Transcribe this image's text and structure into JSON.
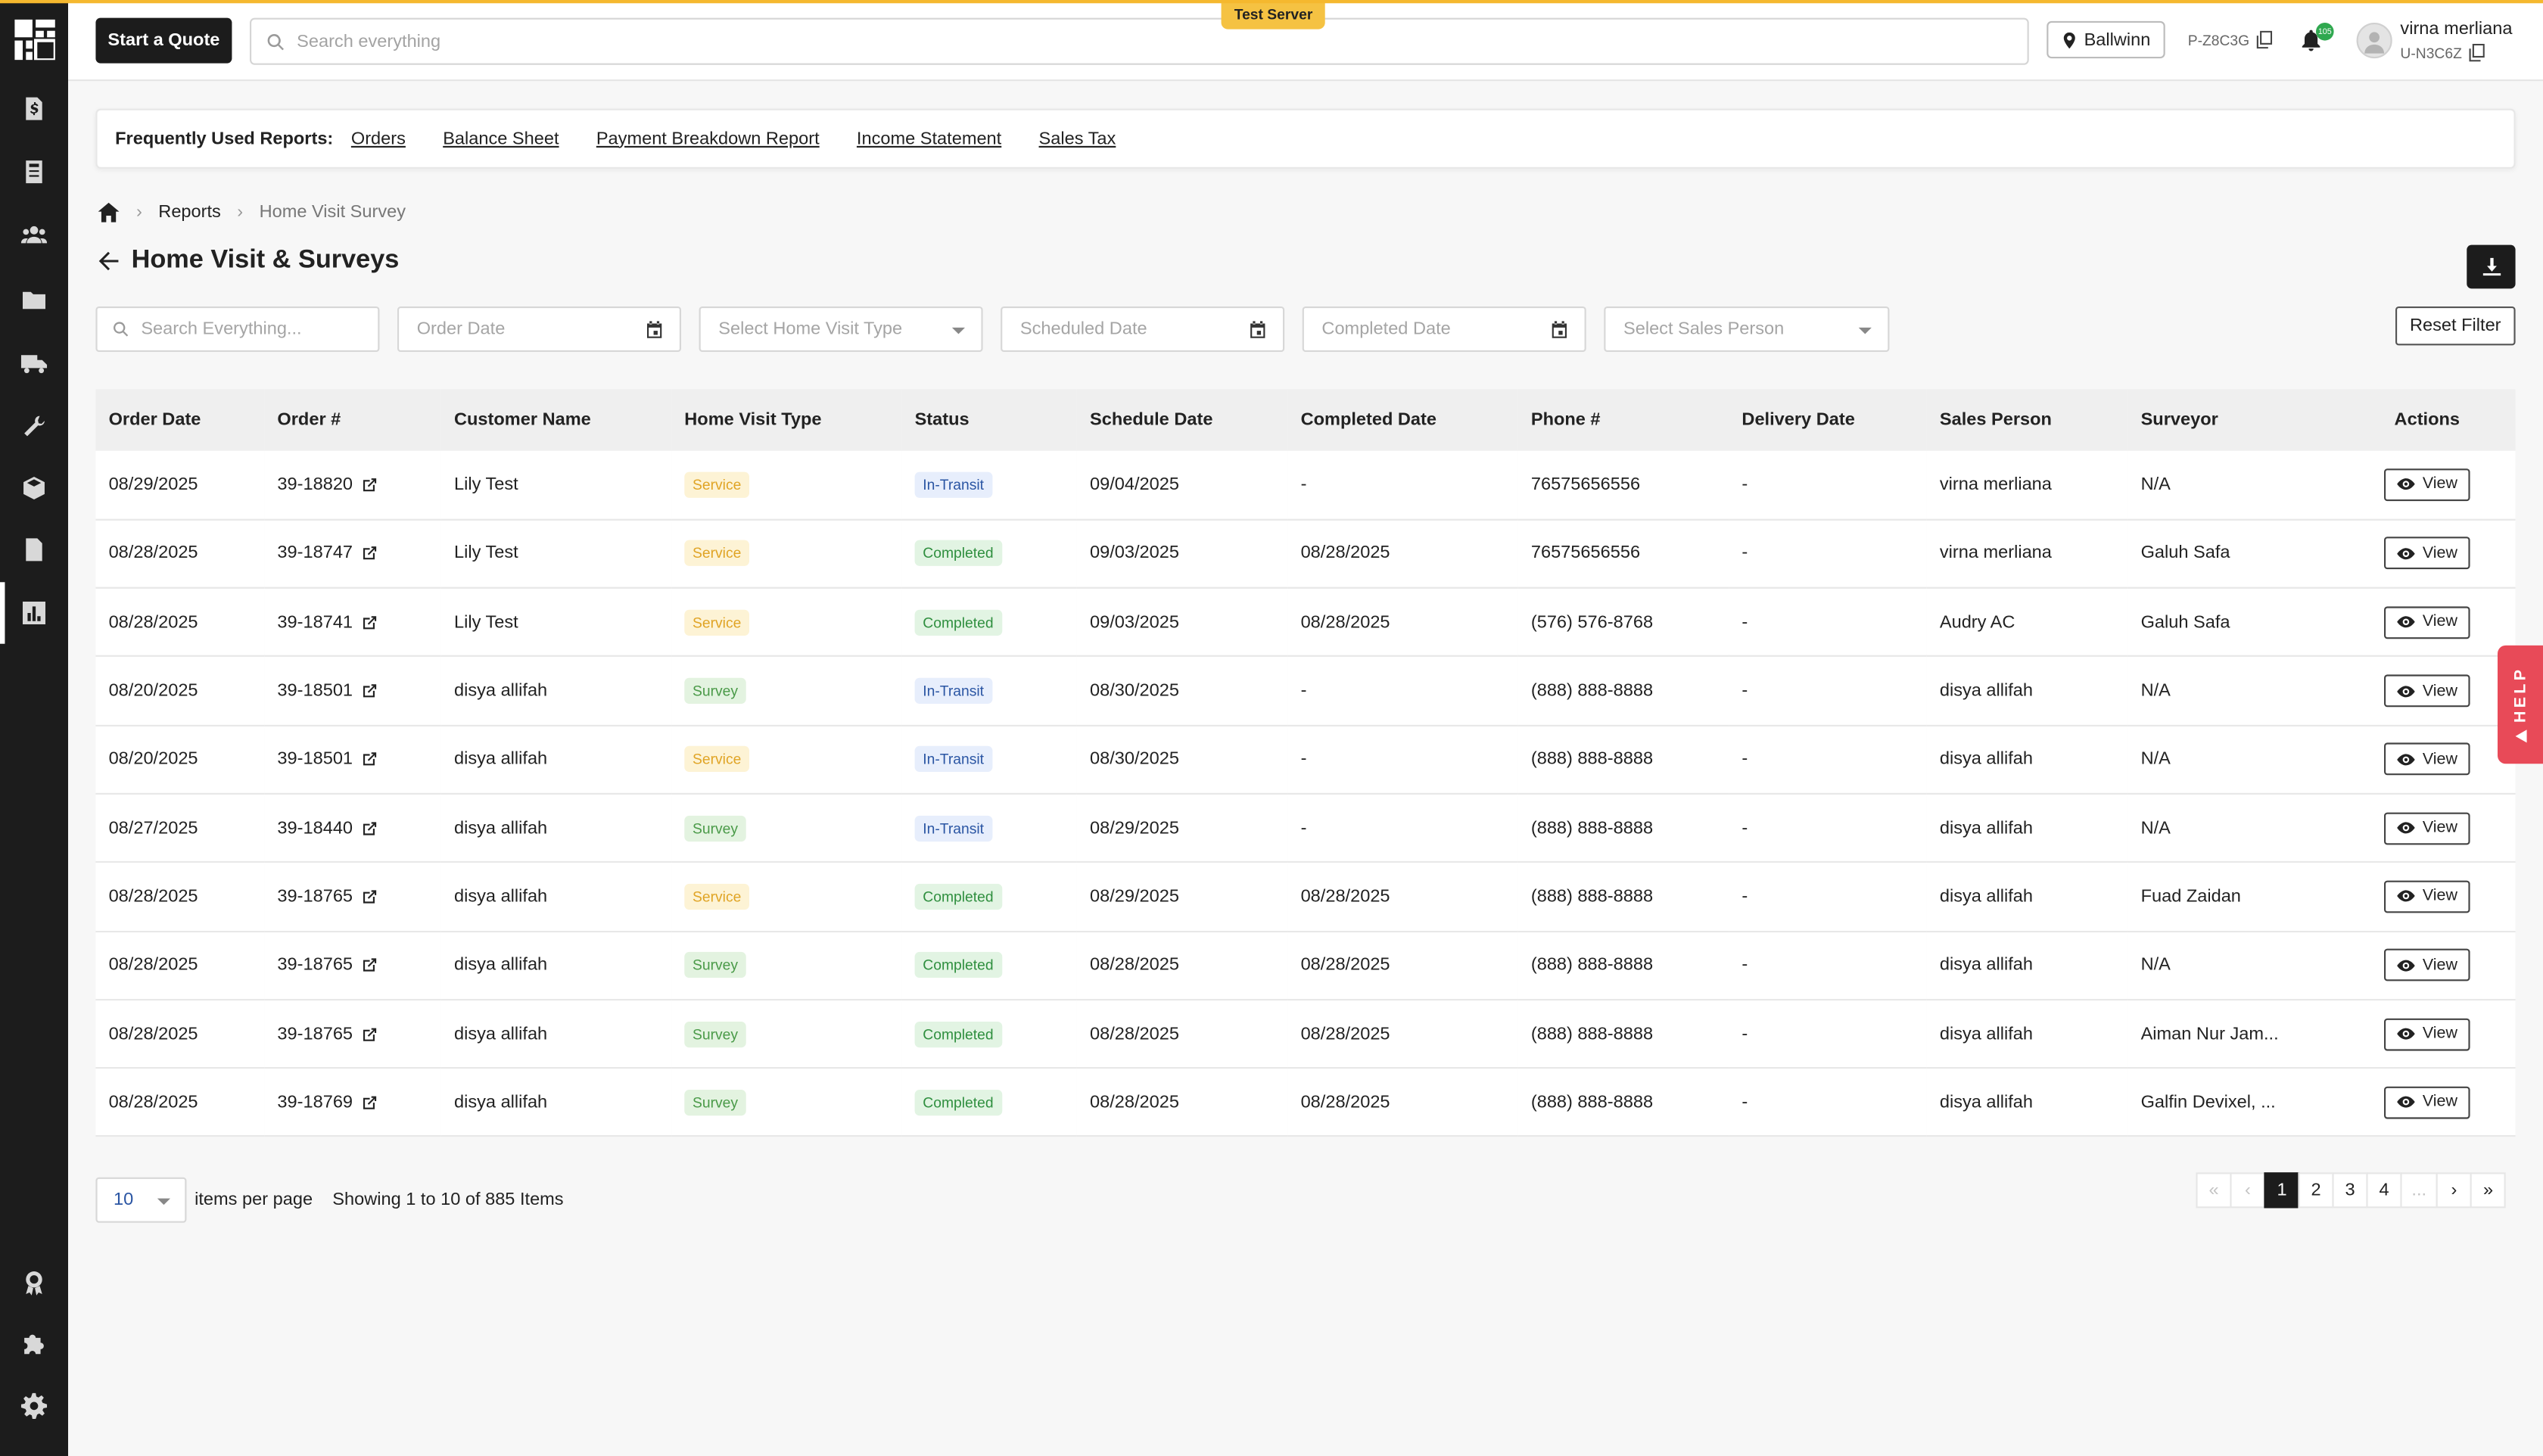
{
  "header": {
    "quote_button": "Start a Quote",
    "search_placeholder": "Search everything",
    "test_server_label": "Test Server",
    "location": "Ballwinn",
    "p_code": "P-Z8C3G",
    "notification_count": "105",
    "user_name": "virna merliana",
    "user_code": "U-N3C6Z"
  },
  "frequent_reports": {
    "label": "Frequently Used Reports:",
    "links": [
      "Orders",
      "Balance Sheet",
      "Payment Breakdown Report",
      "Income Statement",
      "Sales Tax"
    ]
  },
  "breadcrumb": {
    "reports": "Reports",
    "current": "Home Visit Survey"
  },
  "page": {
    "title": "Home Visit & Surveys"
  },
  "filters": {
    "search_placeholder": "Search Everything...",
    "order_date_placeholder": "Order Date",
    "home_visit_type_placeholder": "Select Home Visit Type",
    "scheduled_date_placeholder": "Scheduled Date",
    "completed_date_placeholder": "Completed Date",
    "sales_person_placeholder": "Select Sales Person",
    "reset_label": "Reset Filter"
  },
  "table": {
    "columns": [
      "Order Date",
      "Order #",
      "Customer Name",
      "Home Visit Type",
      "Status",
      "Schedule Date",
      "Completed Date",
      "Phone #",
      "Delivery Date",
      "Sales Person",
      "Surveyor",
      "Actions"
    ],
    "view_label": "View",
    "rows": [
      {
        "order_date": "08/29/2025",
        "order_num": "39-18820",
        "customer": "Lily Test",
        "type": "Service",
        "status": "In-Transit",
        "schedule": "09/04/2025",
        "completed": "-",
        "phone": "76575656556",
        "delivery": "-",
        "sales_person": "virna merliana",
        "surveyor": "N/A"
      },
      {
        "order_date": "08/28/2025",
        "order_num": "39-18747",
        "customer": "Lily Test",
        "type": "Service",
        "status": "Completed",
        "schedule": "09/03/2025",
        "completed": "08/28/2025",
        "phone": "76575656556",
        "delivery": "-",
        "sales_person": "virna merliana",
        "surveyor": "Galuh Safa"
      },
      {
        "order_date": "08/28/2025",
        "order_num": "39-18741",
        "customer": "Lily Test",
        "type": "Service",
        "status": "Completed",
        "schedule": "09/03/2025",
        "completed": "08/28/2025",
        "phone": "(576) 576-8768",
        "delivery": "-",
        "sales_person": "Audry AC",
        "surveyor": "Galuh Safa"
      },
      {
        "order_date": "08/20/2025",
        "order_num": "39-18501",
        "customer": "disya allifah",
        "type": "Survey",
        "status": "In-Transit",
        "schedule": "08/30/2025",
        "completed": "-",
        "phone": "(888) 888-8888",
        "delivery": "-",
        "sales_person": "disya allifah",
        "surveyor": "N/A"
      },
      {
        "order_date": "08/20/2025",
        "order_num": "39-18501",
        "customer": "disya allifah",
        "type": "Service",
        "status": "In-Transit",
        "schedule": "08/30/2025",
        "completed": "-",
        "phone": "(888) 888-8888",
        "delivery": "-",
        "sales_person": "disya allifah",
        "surveyor": "N/A"
      },
      {
        "order_date": "08/27/2025",
        "order_num": "39-18440",
        "customer": "disya allifah",
        "type": "Survey",
        "status": "In-Transit",
        "schedule": "08/29/2025",
        "completed": "-",
        "phone": "(888) 888-8888",
        "delivery": "-",
        "sales_person": "disya allifah",
        "surveyor": "N/A"
      },
      {
        "order_date": "08/28/2025",
        "order_num": "39-18765",
        "customer": "disya allifah",
        "type": "Service",
        "status": "Completed",
        "schedule": "08/29/2025",
        "completed": "08/28/2025",
        "phone": "(888) 888-8888",
        "delivery": "-",
        "sales_person": "disya allifah",
        "surveyor": "Fuad Zaidan"
      },
      {
        "order_date": "08/28/2025",
        "order_num": "39-18765",
        "customer": "disya allifah",
        "type": "Survey",
        "status": "Completed",
        "schedule": "08/28/2025",
        "completed": "08/28/2025",
        "phone": "(888) 888-8888",
        "delivery": "-",
        "sales_person": "disya allifah",
        "surveyor": "N/A"
      },
      {
        "order_date": "08/28/2025",
        "order_num": "39-18765",
        "customer": "disya allifah",
        "type": "Survey",
        "status": "Completed",
        "schedule": "08/28/2025",
        "completed": "08/28/2025",
        "phone": "(888) 888-8888",
        "delivery": "-",
        "sales_person": "disya allifah",
        "surveyor": "Aiman Nur Jam..."
      },
      {
        "order_date": "08/28/2025",
        "order_num": "39-18769",
        "customer": "disya allifah",
        "type": "Survey",
        "status": "Completed",
        "schedule": "08/28/2025",
        "completed": "08/28/2025",
        "phone": "(888) 888-8888",
        "delivery": "-",
        "sales_person": "disya allifah",
        "surveyor": "Galfin Devixel, ..."
      }
    ]
  },
  "pagination": {
    "per_page_value": "10",
    "per_page_label": "items per page",
    "showing_text": "Showing 1 to 10 of 885 Items",
    "first": "«",
    "prev": "‹",
    "pages": [
      "1",
      "2",
      "3",
      "4"
    ],
    "ellipsis": "...",
    "next": "›",
    "last": "»"
  },
  "help": {
    "label": "HELP"
  },
  "colors": {
    "accent": "#f5b82e",
    "sidebar": "#1c1c1c",
    "help": "#e84a58",
    "service_text": "#e0a425",
    "survey_text": "#4a9a48",
    "transit_text": "#2a55a3",
    "completed_text": "#2f8f3f"
  },
  "icons": {
    "sidebar": [
      "invoice-icon",
      "ledger-icon",
      "customers-icon",
      "folder-icon",
      "truck-icon",
      "tools-icon",
      "package-icon",
      "document-icon",
      "reports-icon",
      "badge-icon",
      "puzzle-icon",
      "gear-icon"
    ]
  }
}
